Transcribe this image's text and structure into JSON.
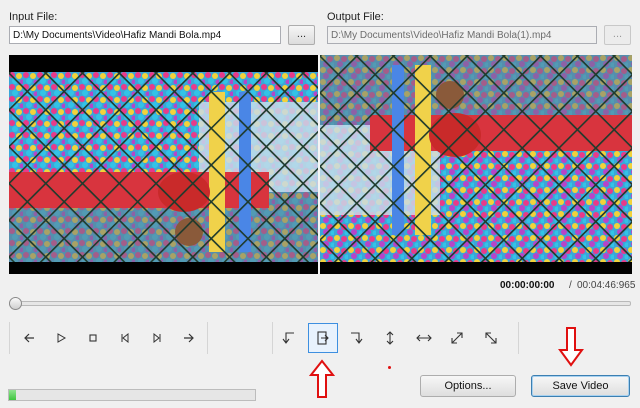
{
  "input": {
    "label": "Input File:",
    "value": "D:\\My Documents\\Video\\Hafiz Mandi Bola.mp4",
    "browse_label": "..."
  },
  "output": {
    "label": "Output File:",
    "value": "D:\\My Documents\\Video\\Hafiz Mandi Bola(1).mp4",
    "browse_label": "..."
  },
  "playback": {
    "current_time": "00:00:00:00",
    "separator": "/",
    "total_time": "00:04:46:965",
    "position": 0
  },
  "transport": {
    "icons": [
      "prev-frame-icon",
      "play-icon",
      "stop-icon",
      "skip-start-icon",
      "skip-end-icon",
      "next-frame-icon"
    ]
  },
  "rotate_tools": {
    "selected_index": 1,
    "icons": [
      "rotate-left-icon",
      "rotate-right-icon",
      "rotate-180-icon",
      "flip-vertical-icon",
      "flip-horizontal-icon",
      "flip-diagonal-icon",
      "flip-antidiagonal-icon"
    ]
  },
  "progress": {
    "fraction": 0.03
  },
  "buttons": {
    "options_label": "Options...",
    "save_label": "Save Video"
  },
  "colors": {
    "annotation_arrow": "#e01010",
    "selected_border": "#3d8fe0",
    "progress_fill": "#3fc53f"
  }
}
